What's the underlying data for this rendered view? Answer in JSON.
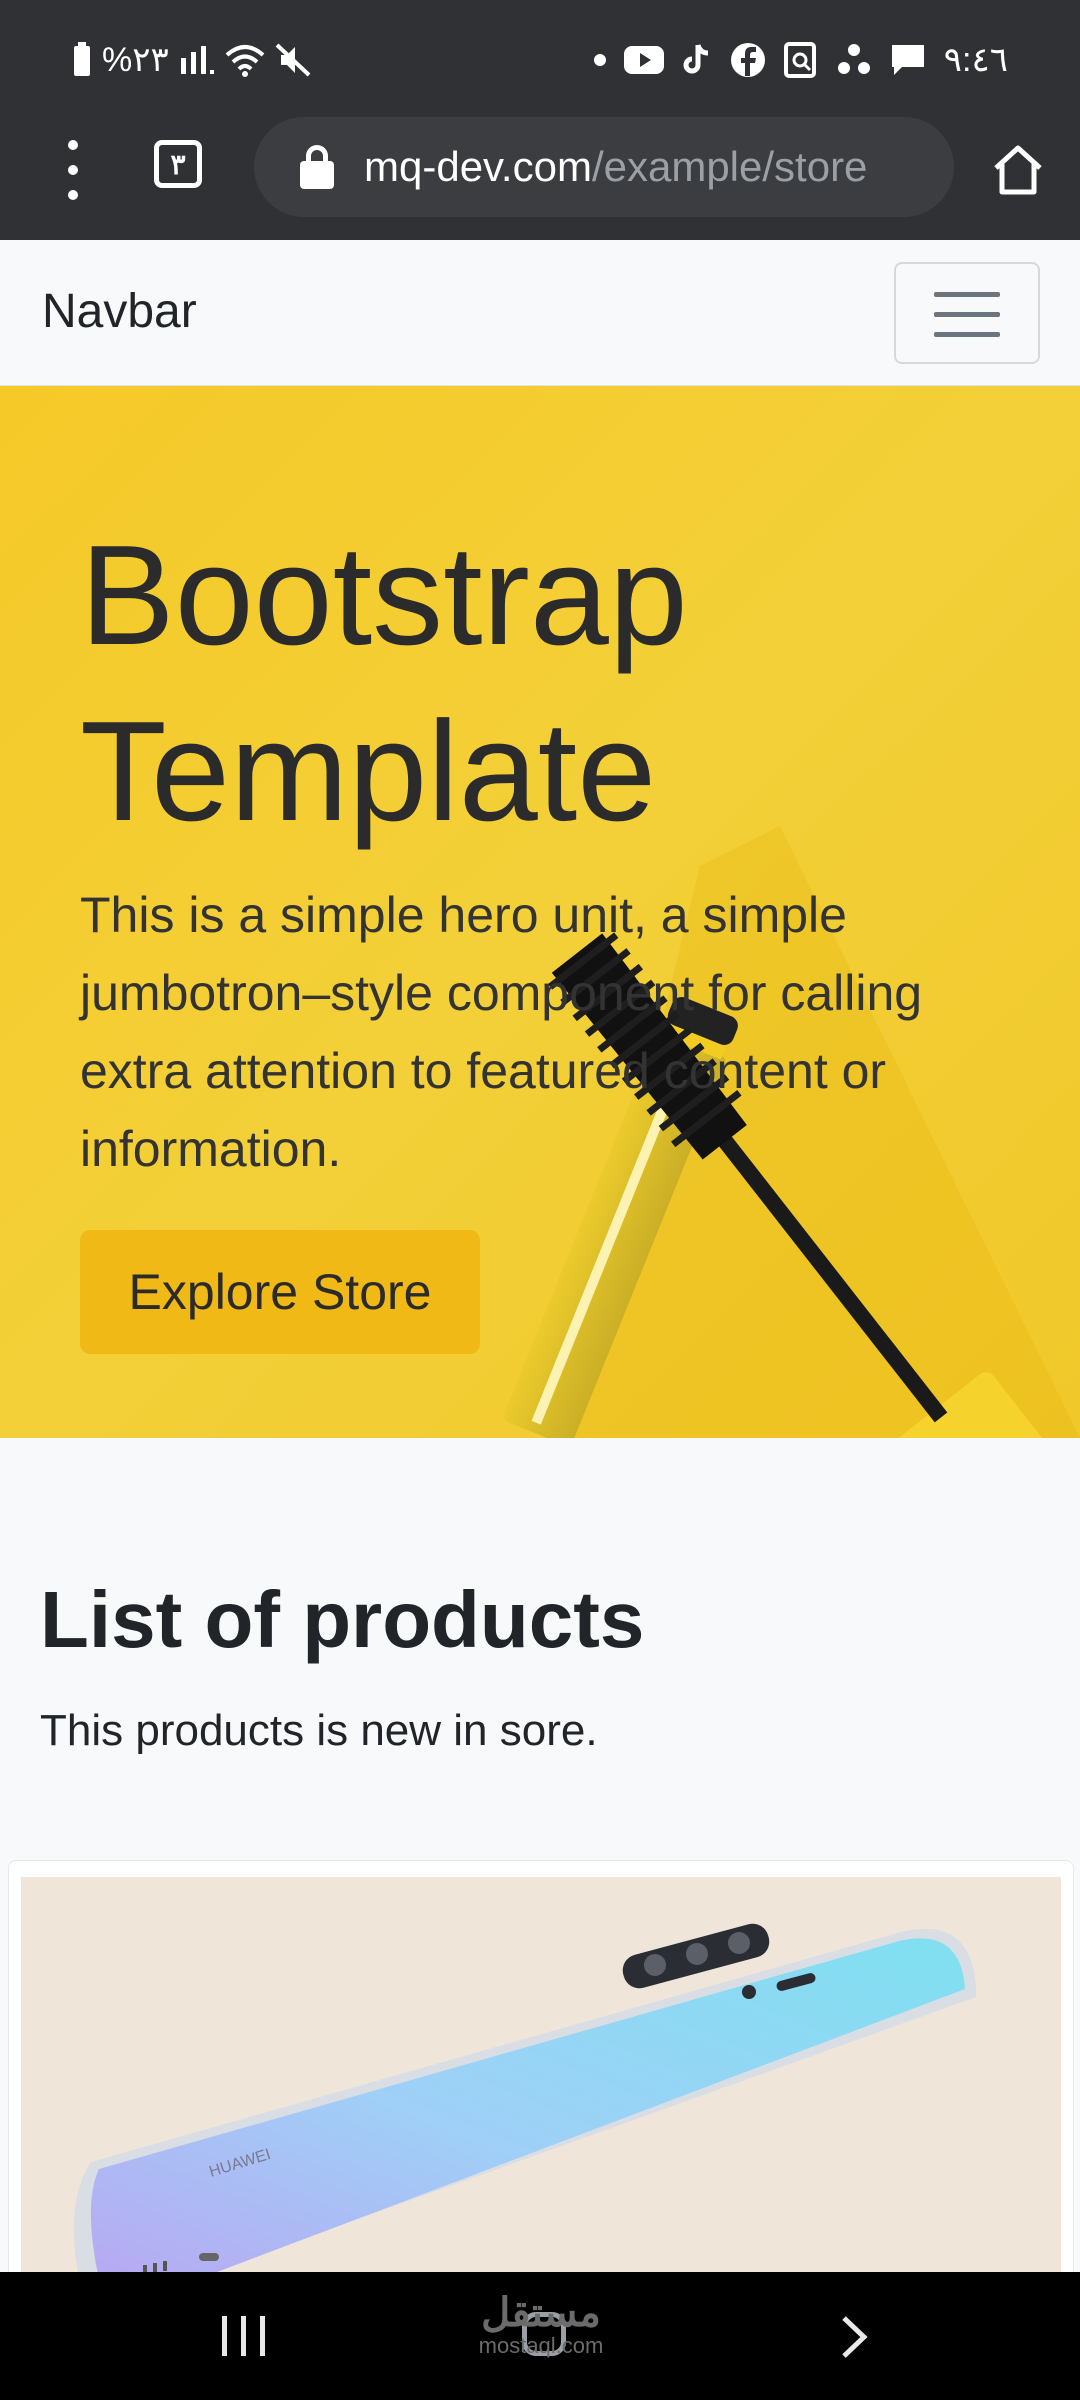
{
  "status_bar": {
    "battery": "%٢٣",
    "time": "٩:٤٦"
  },
  "browser": {
    "tab_count": "٣",
    "url_domain": "mq-dev.com",
    "url_path": "/example/store"
  },
  "navbar": {
    "brand": "Navbar"
  },
  "hero": {
    "title_line1": "Bootstrap",
    "title_line2": "Template",
    "text": "This is a simple hero unit, a simple jumbotron–style component for calling extra attention to featured content or information.",
    "button": "Explore Store"
  },
  "products": {
    "title": "List of products",
    "subtitle": "This products is new in sore."
  },
  "product_card": {
    "phone_brand": "HUAWEI"
  },
  "watermark": {
    "arabic": "مستقل",
    "latin": "mostaql.com"
  },
  "colors": {
    "accent": "#f1b916",
    "hero_bg": "#f3ce33",
    "navbar_bg": "#f8f9fa",
    "status_bar_bg": "#303134"
  }
}
